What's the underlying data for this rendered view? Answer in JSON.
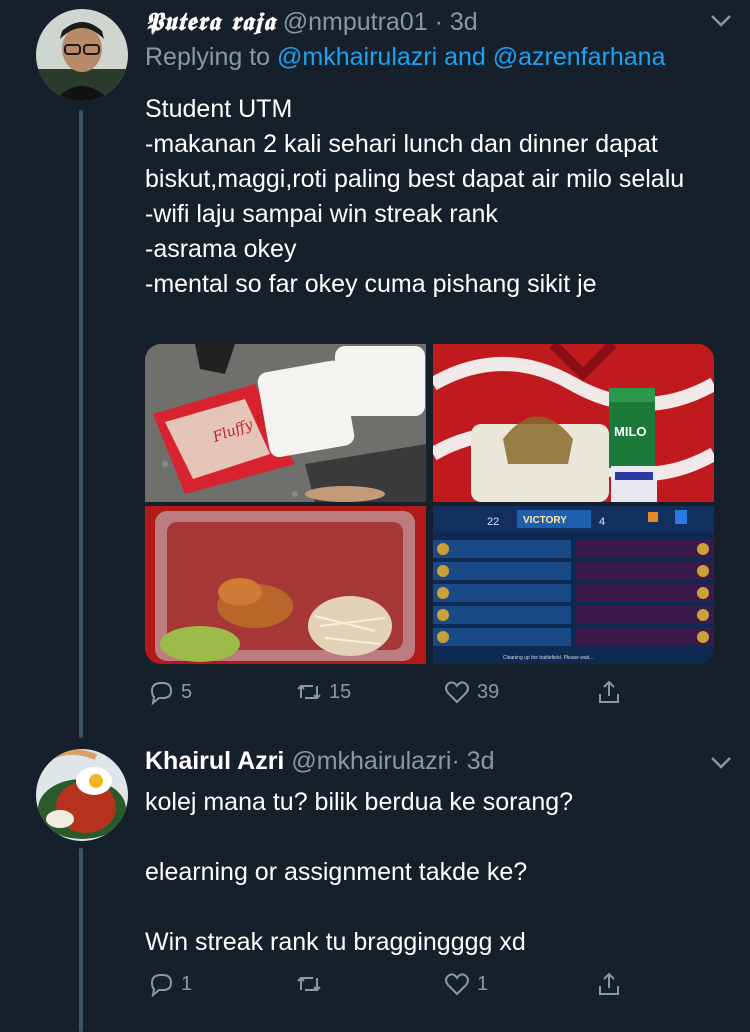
{
  "tweet1": {
    "display_name": "𝕻𝖚𝖙𝖊𝖗𝖆 𝖗𝖆𝖏𝖆",
    "handle": "@nmputra01",
    "separator": "·",
    "time": "3d",
    "replying_prefix": "Replying to",
    "replying_users": "@mkhairulazri and @azrenfarhana",
    "text": "Student UTM\n-makanan 2 kali sehari lunch dan dinner dapat biskut,maggi,roti paling best dapat air milo selalu\n-wifi laju sampai win streak rank\n-asrama okey\n-mental so far okey cuma pishang sikit je",
    "media": {
      "game_score_left": "22",
      "game_result": "VICTORY",
      "game_score_right": "4",
      "game_footer": "Cleaning up the battlefield. Please wait...",
      "snack_brand": "Fluffy Bun",
      "drink_brand": "MILO"
    },
    "replies": "5",
    "retweets": "15",
    "likes": "39"
  },
  "tweet2": {
    "display_name": "Khairul Azri",
    "handle": "@mkhairulazri",
    "separator": "·",
    "time": "3d",
    "text": "kolej mana tu? bilik berdua ke sorang?\n\nelearning or assignment takde ke?\n\nWin streak rank tu braggingggg xd",
    "replies": "1",
    "retweets": "",
    "likes": "1"
  },
  "colors": {
    "background": "#15202b",
    "secondary_text": "#8899a6",
    "link": "#1da1f2",
    "thread_line": "#3d5466"
  },
  "icons": [
    "reply-icon",
    "retweet-icon",
    "like-icon",
    "share-icon",
    "chevron-down-icon"
  ]
}
